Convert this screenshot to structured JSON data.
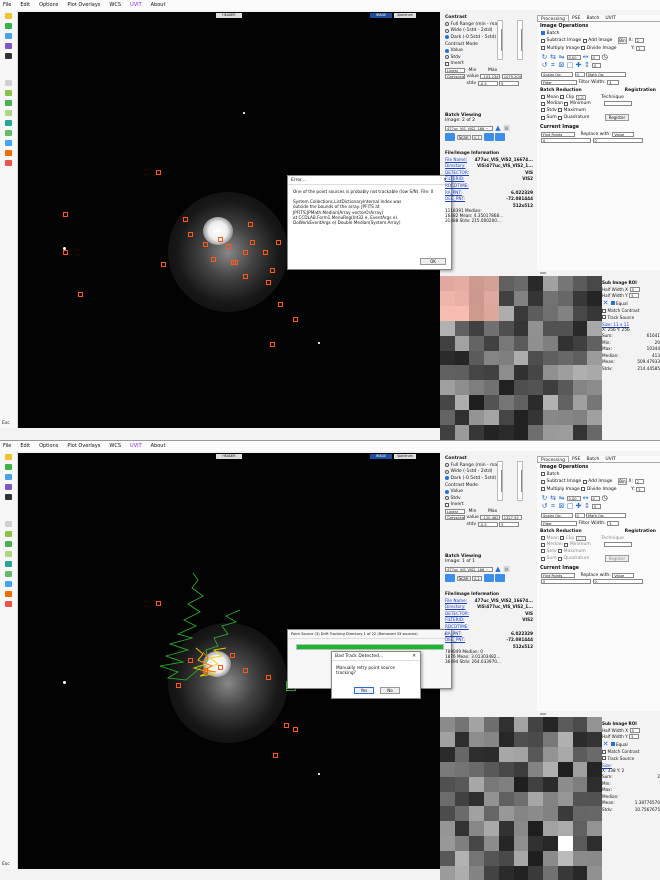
{
  "menu": [
    "File",
    "Edit",
    "Options",
    "Plot Overlays",
    "WCS",
    "UVIT",
    "About"
  ],
  "header_chip": "HEADER",
  "image_chip": "IMAGE",
  "spectrum_chip": "Spectrum",
  "esc": "Esc",
  "top": {
    "contrast": {
      "title": "Contrast",
      "opt_full": "Full Range (min - max)",
      "opt_wide": "Wide (-1std - 2std)",
      "opt_dark": "Dark (-0.5std - 5std)",
      "mode_title": "Contrast Mode",
      "mode_value": "Value",
      "mode_stdv": "Stdv",
      "invert": "Invert",
      "scale": "Linear",
      "colormap": "Greyscale",
      "min_label": "Min",
      "max_label": "Max",
      "value_label": "value",
      "stdv_label": "stdv",
      "min_value": "-103.234",
      "max_value": "1079.204",
      "min_stdv": "-0.5",
      "max_stdv": "5"
    },
    "batch_view": {
      "title": "Batch Viewing",
      "image_of": "Image: 2 of 2",
      "file": "477uc_VIS_VIS2_166 ~",
      "scan": "Scan",
      "scan_val": "0.2"
    },
    "fileinfo": {
      "title": "File/Image Information",
      "rows": [
        [
          "File Name:",
          "477uc_VIS_VIS2_16674..."
        ],
        [
          "Directory:",
          "VIS\\477uc_VIS_VIS2_1..."
        ],
        [
          "DETECTOR:",
          "VIS"
        ],
        [
          "FILTERID:",
          "VIS2"
        ],
        [
          "RDCDTIME:",
          ""
        ],
        [
          "RA_PNT:",
          "6.022329"
        ],
        [
          "DEC_PNT:",
          "-72.081444"
        ],
        [
          "",
          "512x512"
        ]
      ],
      "stats": [
        "1118391  Median:",
        "  16482  Mean:  4.35017868...",
        "  31488  Stdv:  215.000200..."
      ]
    },
    "error_dialog": {
      "title": "Error...",
      "msg": "One of the point sources is probably not trackable (low S/N). File: 0",
      "trace1": "System.Collections.ListDictionaryInternal          Index was",
      "trace2": "outside the bounds of the array.          JPFITS       at",
      "trace3": "JPFITS.JPMath.Median(Array vectorOrArray)",
      "trace4": "  at CCDLAB.Form1.MenuReg(Int32 e, EventArgs e)",
      "trace5": "DoWorkEventArgs e)            Double Median(System.Array)",
      "ok": "OK"
    },
    "proc": {
      "tabs": [
        "Processing",
        "PSE",
        "Batch",
        "UVIT"
      ],
      "ops_title": "Image Operations",
      "batch": "Batch"
    },
    "subroi": {
      "title": "Sub Image ROI",
      "hwx": "Half Width X",
      "hwy": "Half Width Y",
      "hw_val": "5",
      "equal": "Equal",
      "match": "Match Contrast",
      "track": "Track Source",
      "size": "Size:  11 x 11",
      "xy": "X:    256   Y:    256",
      "sum_l": "Sum:",
      "sum": "61641",
      "min_l": "Min:",
      "min": "20",
      "max_l": "Max:",
      "max": "10344",
      "med_l": "Median:",
      "med": "413",
      "mean_l": "Mean:",
      "mean": "509.47933",
      "stdv_l": "Stdv:",
      "stdv": "214.44585"
    }
  },
  "bottom": {
    "contrast": {
      "title": "Contrast",
      "opt_full": "Full Range (min - max)",
      "opt_wide": "Wide (-1std - 2std)",
      "opt_dark": "Dark (-0.5std - 5std)",
      "mode_title": "Contrast Mode",
      "mode_value": "Value",
      "mode_stdv": "Stdv",
      "invert": "Invert",
      "scale": "Linear",
      "colormap": "Greyscale",
      "min_label": "Min",
      "max_label": "Max",
      "value_label": "value",
      "stdv_label": "stdv",
      "min_value": "-120.462",
      "max_value": "1327.92",
      "min_stdv": "-0.5",
      "max_stdv": "5"
    },
    "batch_view": {
      "title": "Batch Viewing",
      "image_of": "Image: 1 of 1",
      "file": "477uc_VIS_VIS2_166 ~",
      "scan": "Scan",
      "scan_val": "0.2"
    },
    "fileinfo": {
      "title": "File/Image Information",
      "rows": [
        [
          "File Name:",
          "477uc_VIS_VIS2_16674..."
        ],
        [
          "Directory:",
          "VIS\\477uc_VIS_VIS2_1..."
        ],
        [
          "DETECTOR:",
          "VIS"
        ],
        [
          "FILTERID:",
          "VIS2"
        ],
        [
          "RDCDTIME:",
          ""
        ],
        [
          "RA_PNT:",
          "6.022329"
        ],
        [
          "DEC_PNT:",
          "-72.081444"
        ],
        [
          "",
          "512x512"
        ]
      ],
      "stats": [
        "789049  Median:        0",
        "  1876  Mean:  3.01303482...",
        " 36494  Stdv:  264.033970..."
      ]
    },
    "progress_window": {
      "title": "Point Source (3) Drift Tracking Directory 1 of 22 (Removed 33 sources)",
      "progress": 1
    },
    "bad_track": {
      "title": "Bad Track Detected...",
      "msg": "Manually retry point source tracking?",
      "yes": "Yes",
      "no": "No"
    },
    "proc": {
      "tabs": [
        "Processing",
        "PSE",
        "Batch",
        "UVIT"
      ],
      "ops_title": "Image Operations",
      "batch": "Batch"
    },
    "subroi": {
      "title": "Sub Image ROI",
      "hwx": "Half Width X",
      "hwy": "Half Width Y",
      "hw_val": "5",
      "equal": "Equal",
      "match": "Match Contrast",
      "track": "Track Source",
      "size": "Size:",
      "xy": "X:    338   Y:    2",
      "sum_l": "Sum:",
      "sum": "2",
      "min_l": "Min:",
      "min": "",
      "max_l": "Max:",
      "max": "",
      "med_l": "Median:",
      "med": "",
      "mean_l": "Mean:",
      "mean": "1.38776570",
      "stdv_l": "Stdv:",
      "stdv": "10.7567675"
    }
  },
  "proc_labels": {
    "subtract": "Subtract Image",
    "add": "Add Image",
    "multiply": "Multiply Image",
    "divide": "Divide Image",
    "bin": "Bin",
    "x": "X:",
    "y": "Y:",
    "two": "2",
    "rot": "0.00",
    "zero": "0",
    "scalar_op": "Scalar Op:",
    "math_op": "Math Op:",
    "filter": "Filter",
    "filter_width": "Filter Width:",
    "three": "3",
    "batch_red": "Batch Reduction",
    "registration": "Registration",
    "technique": "Technique",
    "mean": "Mean",
    "clip": "Clip",
    "clip_val": "1.0",
    "median": "Median",
    "minimum": "Minimum",
    "stdv": "Stdv",
    "maximum": "Maximum",
    "sum": "Sum",
    "quadrature": "Quadrature",
    "register": "Register",
    "current": "Current Image",
    "find_points": "Find Points",
    "replace_with": "Replace with:",
    "value": "Value"
  },
  "colors": {
    "accent": "#2a6fd6",
    "marker": "#ff5a1a",
    "track_green": "#2fb82f",
    "progress": "#18b82e"
  }
}
